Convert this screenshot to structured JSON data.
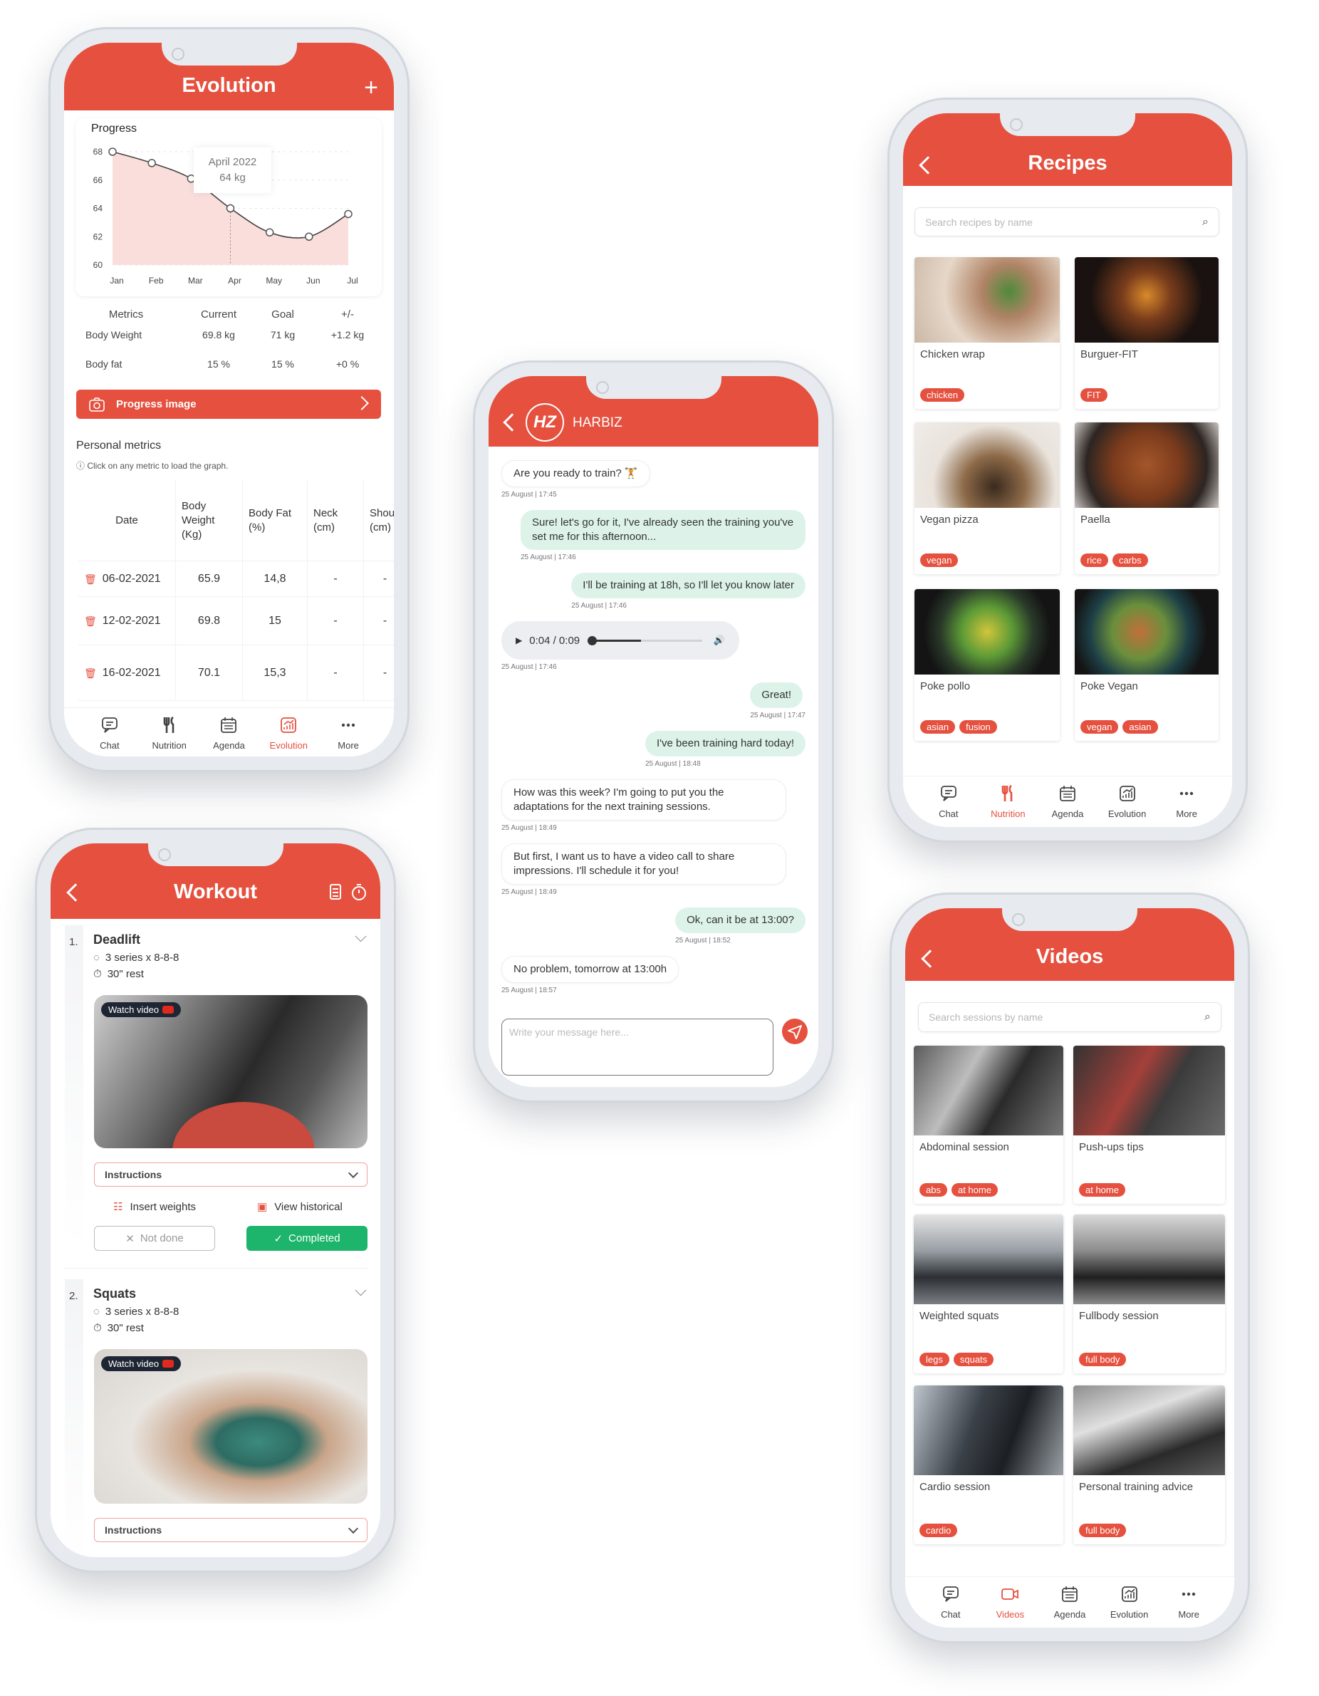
{
  "evolution": {
    "title": "Evolution",
    "add_icon": "plus-icon",
    "progress_label": "Progress",
    "tooltip": {
      "line1": "April 2022",
      "line2": "64 kg"
    },
    "metrics": {
      "headers": [
        "Metrics",
        "Current",
        "Goal",
        "+/-"
      ],
      "rows": [
        [
          "Body Weight",
          "69.8 kg",
          "71 kg",
          "+1.2 kg"
        ],
        [
          "Body fat",
          "15 %",
          "15 %",
          "+0 %"
        ]
      ]
    },
    "progress_button": "Progress image",
    "personal_title": "Personal metrics",
    "personal_hint": "Click on any metric to load the graph.",
    "table": {
      "headers": [
        "Date",
        "Body Weight (Kg)",
        "Body Fat (%)",
        "Neck (cm)",
        "Shoulder (cm)"
      ],
      "rows": [
        [
          "06-02-2021",
          "65.9",
          "14,8",
          "-",
          "-"
        ],
        [
          "12-02-2021",
          "69.8",
          "15",
          "-",
          "-"
        ],
        [
          "16-02-2021",
          "70.1",
          "15,3",
          "-",
          "-"
        ]
      ]
    },
    "nav": [
      {
        "label": "Chat",
        "icon": "chat"
      },
      {
        "label": "Nutrition",
        "icon": "nutrition"
      },
      {
        "label": "Agenda",
        "icon": "agenda"
      },
      {
        "label": "Evolution",
        "icon": "evolution",
        "active": true
      },
      {
        "label": "More",
        "icon": "more"
      }
    ]
  },
  "chart_data": {
    "type": "area",
    "categories": [
      "Jan",
      "Feb",
      "Mar",
      "Apr",
      "May",
      "Jun",
      "Jul"
    ],
    "values": [
      68,
      67.2,
      66.1,
      64,
      62.3,
      62,
      63.6
    ],
    "yticks": [
      60,
      62,
      64,
      66,
      68
    ],
    "ylim": [
      60,
      68
    ],
    "grid": true,
    "highlight": "Apr",
    "fill_color": "#f9dedb",
    "line_color": "#444444"
  },
  "workout": {
    "title": "Workout",
    "exercises": [
      {
        "num": "1.",
        "name": "Deadlift",
        "series": "3 series x 8-8-8",
        "rest": "30\" rest",
        "watch": "Watch video",
        "instructions": "Instructions",
        "insert": "Insert weights",
        "historical": "View historical",
        "not_done": "Not done",
        "completed": "Completed"
      },
      {
        "num": "2.",
        "name": "Squats",
        "series": "3 series x 8-8-8",
        "rest": "30\" rest",
        "watch": "Watch video",
        "instructions": "Instructions"
      }
    ]
  },
  "chat": {
    "brand": "HARBIZ",
    "logo": "HZ",
    "messages": [
      {
        "side": "recv",
        "text": "Are you ready to train? 🏋",
        "time": "25 August | 17:45"
      },
      {
        "side": "sent",
        "text": "Sure! let's go for it, I've already seen the training you've set me for this afternoon...",
        "time": "25 August | 17:46"
      },
      {
        "side": "sent",
        "text": "I'll be training at 18h, so I'll let you know later",
        "time": "25 August | 17:46"
      },
      {
        "side": "recv",
        "type": "audio",
        "text": "0:04 / 0:09",
        "progress": 0.45,
        "time": "25 August | 17:46"
      },
      {
        "side": "sent",
        "text": "Great!",
        "time": "25 August | 17:47"
      },
      {
        "side": "sent",
        "text": "I've been training hard today!",
        "time": "25 August | 18:48"
      },
      {
        "side": "recv",
        "text": "How was this week? I'm going to put you the adaptations for the next training sessions.",
        "time": "25 August | 18:49"
      },
      {
        "side": "recv",
        "text": "But first, I want us to have a video call to share impressions. I'll schedule it for you!",
        "time": "25 August | 18:49"
      },
      {
        "side": "sent",
        "text": "Ok, can it be at 13:00?",
        "time": "25 August | 18:52"
      },
      {
        "side": "recv",
        "text": "No problem, tomorrow at 13:00h",
        "time": "25 August | 18:57"
      }
    ],
    "input_placeholder": "Write your message here..."
  },
  "recipes": {
    "title": "Recipes",
    "search_placeholder": "Search recipes by name",
    "items": [
      {
        "name": "Chicken wrap",
        "tags": [
          "chicken"
        ]
      },
      {
        "name": "Burguer-FIT",
        "tags": [
          "FIT"
        ]
      },
      {
        "name": "Vegan pizza",
        "tags": [
          "vegan"
        ]
      },
      {
        "name": "Paella",
        "tags": [
          "rice",
          "carbs"
        ]
      },
      {
        "name": "Poke pollo",
        "tags": [
          "asian",
          "fusion"
        ]
      },
      {
        "name": "Poke Vegan",
        "tags": [
          "vegan",
          "asian"
        ]
      }
    ],
    "nav": [
      {
        "label": "Chat",
        "icon": "chat"
      },
      {
        "label": "Nutrition",
        "icon": "nutrition",
        "active": true
      },
      {
        "label": "Agenda",
        "icon": "agenda"
      },
      {
        "label": "Evolution",
        "icon": "evolution"
      },
      {
        "label": "More",
        "icon": "more"
      }
    ]
  },
  "videos": {
    "title": "Videos",
    "search_placeholder": "Search sessions by name",
    "items": [
      {
        "name": "Abdominal session",
        "tags": [
          "abs",
          "at home"
        ]
      },
      {
        "name": "Push-ups tips",
        "tags": [
          "at home"
        ]
      },
      {
        "name": "Weighted squats",
        "tags": [
          "legs",
          "squats"
        ]
      },
      {
        "name": "Fullbody session",
        "tags": [
          "full body"
        ]
      },
      {
        "name": "Cardio session",
        "tags": [
          "cardio"
        ]
      },
      {
        "name": "Personal training advice",
        "tags": [
          "full body"
        ]
      }
    ],
    "nav": [
      {
        "label": "Chat",
        "icon": "chat"
      },
      {
        "label": "Videos",
        "icon": "video",
        "active": true
      },
      {
        "label": "Agenda",
        "icon": "agenda"
      },
      {
        "label": "Evolution",
        "icon": "evolution"
      },
      {
        "label": "More",
        "icon": "more"
      }
    ]
  },
  "colors": {
    "brand": "#E5503F",
    "completed": "#1DB56B",
    "sent_bubble": "#DDF3EA"
  }
}
